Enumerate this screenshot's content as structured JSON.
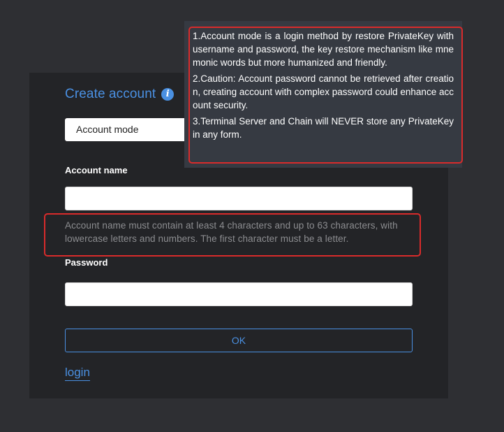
{
  "form": {
    "title": "Create account",
    "mode_value": "Account mode",
    "account_name_label": "Account name",
    "account_name_value": "",
    "account_name_hint": "Account name must contain at least 4 characters and up to 63 characters, with lowercase letters and numbers. The first character must be a letter.",
    "password_label": "Password",
    "password_value": "",
    "ok_label": "OK",
    "login_label": "login"
  },
  "tooltip": {
    "lines": [
      "1.Account mode is a login method by restore PrivateKey with username and password, the key restore mechanism like mnemonic words but more humanized and friendly.",
      "2.Caution: Account password cannot be retrieved after creation, creating account with complex password could enhance account security.",
      "3.Terminal Server and Chain will NEVER store any PrivateKey in any form."
    ]
  },
  "icons": {
    "info": "info-icon"
  },
  "colors": {
    "accent": "#4a90e2",
    "highlight": "#d92b2b",
    "background": "#2e2f33",
    "card": "#232427",
    "tooltip_bg": "#363a42"
  }
}
